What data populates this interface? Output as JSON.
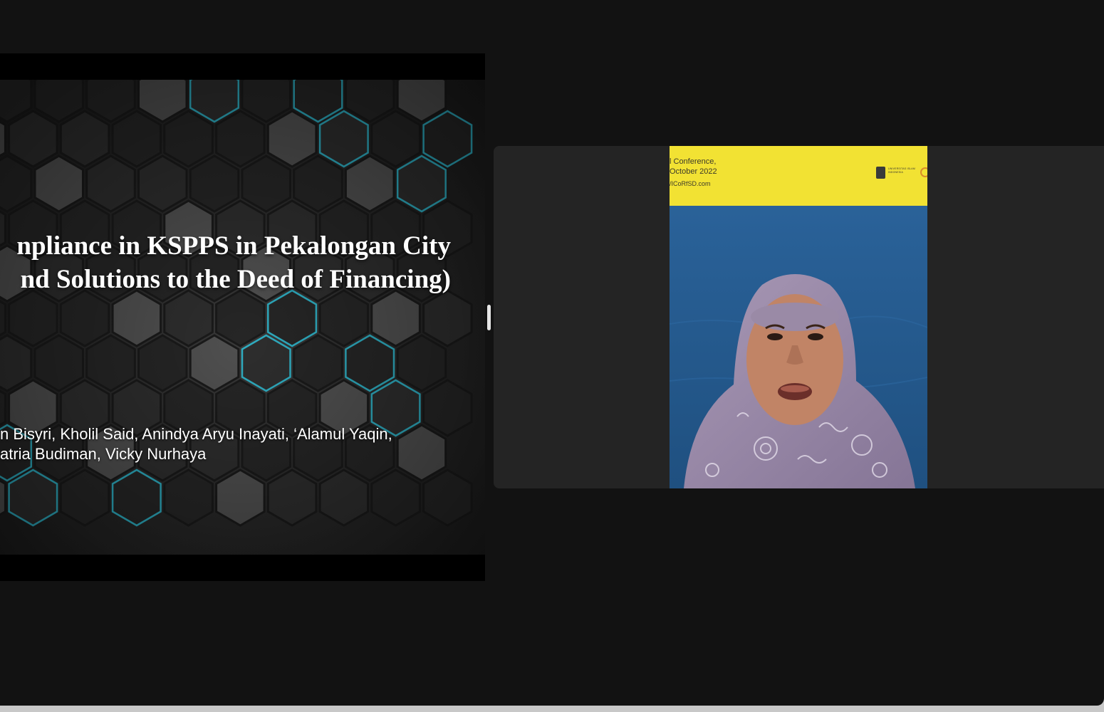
{
  "slide": {
    "title_line1": "npliance in KSPPS in Pekalongan City",
    "title_line2": "nd Solutions to the Deed of Financing)",
    "authors_line1": "n Bisyri, Kholil Said, Anindya Aryu Inayati, ‘Alamul Yaqin,",
    "authors_line2": "atria Budiman, Vicky Nurhaya"
  },
  "video": {
    "banner_line1": "l Conference,",
    "banner_line2": "October 2022",
    "banner_url": "/ICoRfSD.com",
    "banner_logo_text": "UNIVERSITAS ISLAM INDONESIA",
    "colors": {
      "banner": "#f2e233",
      "backdrop": "#2a5f93",
      "hijab": "#9a8aa6"
    }
  },
  "colors": {
    "background": "#121212",
    "hex_glow": "#2fc4dc",
    "tile": "#242424"
  }
}
